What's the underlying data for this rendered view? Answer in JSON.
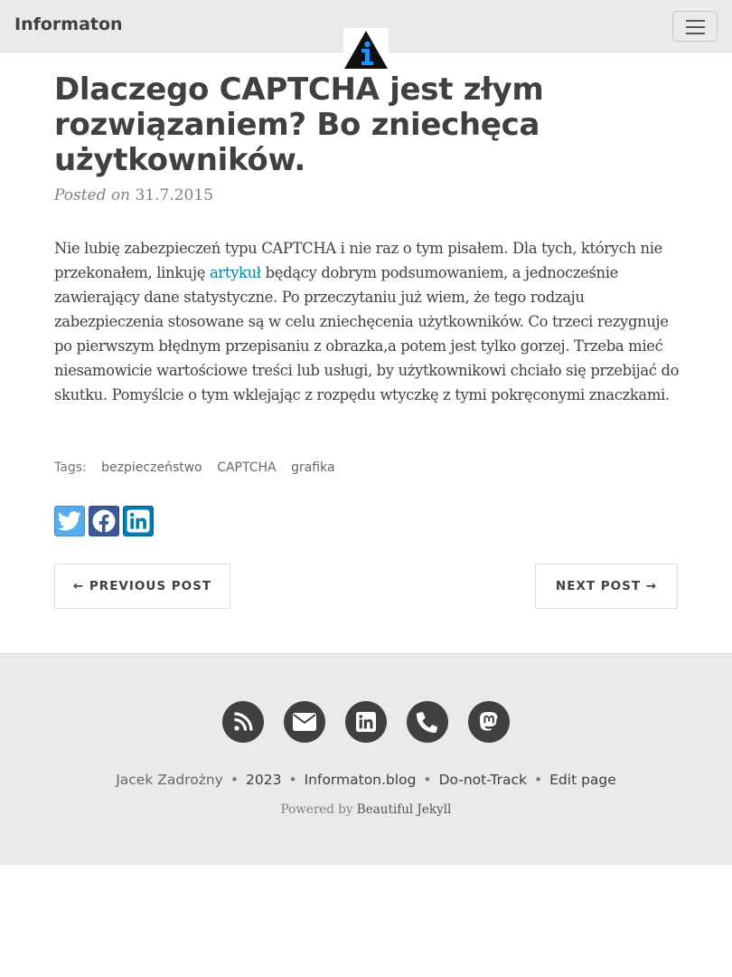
{
  "navbar": {
    "brand": "Informaton",
    "menu_icon": "hamburger-icon",
    "avatar_icon": "info-logo"
  },
  "post": {
    "title": "Dlaczego CAPTCHA jest złym rozwiązaniem? Bo zniechęca użytkowników.",
    "posted_on_label": "Posted on",
    "date": "31.7.2015",
    "body_before_link": "Nie lubię zabezpieczeń typu CAPTCHA i nie raz o tym pisałem. Dla tych, których nie przekonałem, linkuję ",
    "body_link": "artykuł",
    "body_after_link": " będący dobrym podsumowaniem, a jednocześnie zawierający dane statystyczne. Po przeczytaniu już wiem, że tego rodzaju zabezpieczenia stosowane są w celu zniechęcenia użytkowników. Co trzeci rezygnuje po pierwszym błędnym przepisaniu z obrazka,a potem jest tylko gorzej. Trzeba mieć niesamowicie wartościowe treści lub usługi, by użytkownikowi chciało się przebijać do skutku. Pomyślcie o tym wklejając z rozpędu wtyczkę z tymi pokręconymi znaczkami.",
    "tags_label": "Tags:",
    "tags": [
      "bezpieczeństwo",
      "CAPTCHA",
      "grafika"
    ]
  },
  "share": {
    "icons": [
      "twitter-icon",
      "facebook-icon",
      "linkedin-icon"
    ],
    "colors": [
      "#55acee",
      "#3b5998",
      "#007bb5"
    ]
  },
  "pager": {
    "previous_label": "← PREVIOUS POST",
    "next_label": "NEXT POST →"
  },
  "footer": {
    "icons": [
      "rss-icon",
      "email-icon",
      "linkedin-icon",
      "phone-icon",
      "mastodon-icon"
    ],
    "author": "Jacek Zadrożny",
    "year": "2023",
    "site": "Informaton.blog",
    "dnt": "Do-not-Track",
    "edit": "Edit page",
    "powered_prefix": "Powered by",
    "powered_link": "Beautiful Jekyll",
    "separator": "•"
  },
  "colors": {
    "navbar_bg": "#eaeaea",
    "link": "#0085a1",
    "text": "#404040",
    "logo_blue": "#1e90ff"
  }
}
